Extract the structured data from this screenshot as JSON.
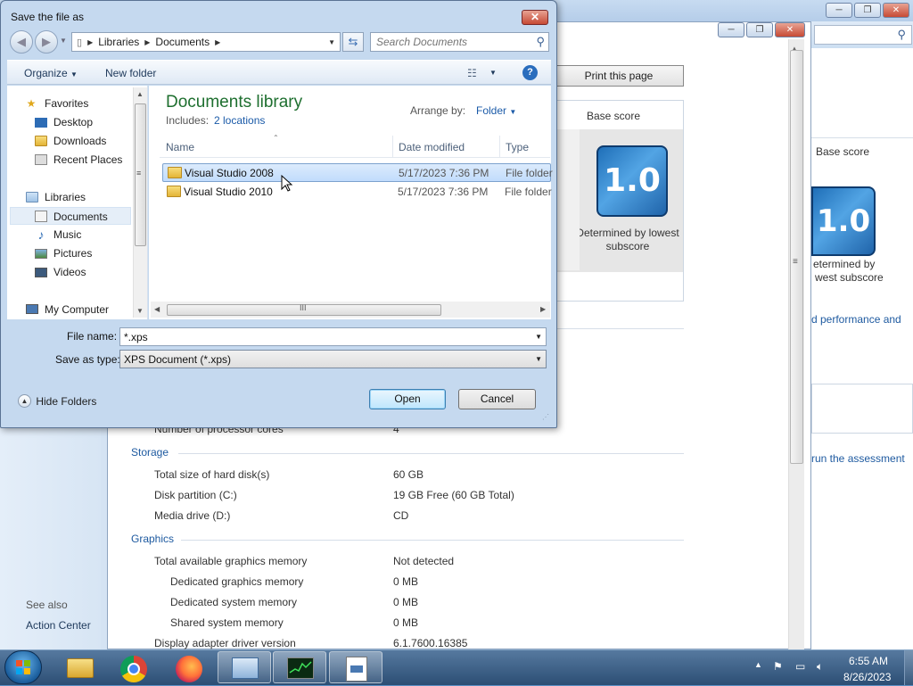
{
  "dialog": {
    "title": "Save the file as",
    "close_label": "✕",
    "breadcrumb": [
      "Libraries",
      "Documents"
    ],
    "search_placeholder": "Search Documents",
    "toolbar": {
      "organize": "Organize",
      "new_folder": "New folder"
    },
    "nav": {
      "favorites": "Favorites",
      "desktop": "Desktop",
      "downloads": "Downloads",
      "recent_places": "Recent Places",
      "libraries": "Libraries",
      "documents": "Documents",
      "music": "Music",
      "pictures": "Pictures",
      "videos": "Videos",
      "my_computer": "My Computer"
    },
    "library": {
      "title": "Documents library",
      "includes_label": "Includes:",
      "locations": "2 locations",
      "arrange_label": "Arrange by:",
      "arrange_value": "Folder"
    },
    "columns": {
      "name": "Name",
      "date": "Date modified",
      "type": "Type"
    },
    "files": [
      {
        "name": "Visual Studio 2008",
        "date": "5/17/2023 7:36 PM",
        "type": "File folder",
        "selected": true
      },
      {
        "name": "Visual Studio 2010",
        "date": "5/17/2023 7:36 PM",
        "type": "File folder",
        "selected": false
      }
    ],
    "file_name_label": "File name:",
    "file_name_value": "*.xps",
    "save_type_label": "Save as type:",
    "save_type_value": "XPS Document (*.xps)",
    "hide_folders": "Hide Folders",
    "open_button": "Open",
    "cancel_button": "Cancel"
  },
  "background": {
    "print_button": "Print this page",
    "base_score_header": "Base score",
    "score": "1.0",
    "determined_by": "Determined by lowest subscore",
    "right_base_score": "Base score",
    "right_determined": "etermined by",
    "right_lowest": "west subscore",
    "right_perf_link": "d performance and",
    "right_rerun_link": "run the assessment",
    "see_also": "See also",
    "action_center": "Action Center",
    "processor_cores_label": "Number of processor cores",
    "processor_cores_value": "4",
    "storage_header": "Storage",
    "graphics_header": "Graphics",
    "rows": [
      {
        "label": "Total size of hard disk(s)",
        "value": "60 GB"
      },
      {
        "label": "Disk partition (C:)",
        "value": "19 GB Free (60 GB Total)"
      },
      {
        "label": "Media drive (D:)",
        "value": "CD"
      },
      {
        "label": "Total available graphics memory",
        "value": "Not detected"
      },
      {
        "label": "Dedicated graphics memory",
        "value": "0 MB"
      },
      {
        "label": "Dedicated system memory",
        "value": "0 MB"
      },
      {
        "label": "Shared system memory",
        "value": "0 MB"
      },
      {
        "label": "Display adapter driver version",
        "value": "6.1.7600.16385"
      }
    ]
  },
  "taskbar": {
    "time": "6:55 AM",
    "date": "8/26/2023",
    "apps": [
      "file-explorer",
      "chrome",
      "firefox",
      "control-panel",
      "task-manager",
      "xps-viewer"
    ]
  }
}
